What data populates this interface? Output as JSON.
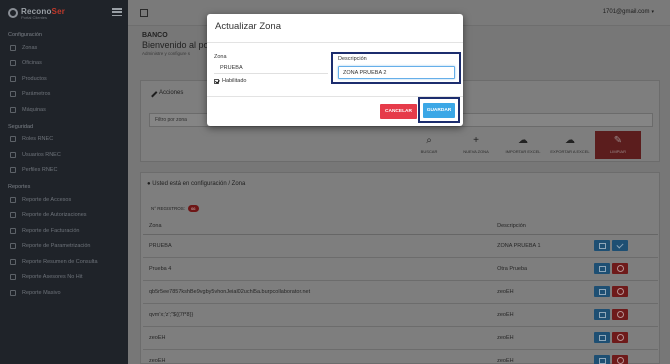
{
  "brand": {
    "name_main": "Recono",
    "name_accent": "Ser",
    "subtitle": "Portal Clientes"
  },
  "sidebar": {
    "sections": [
      {
        "title": "Configuración",
        "items": [
          "Zonas",
          "Oficinas",
          "Productos",
          "Parámetros",
          "Máquinas"
        ]
      },
      {
        "title": "Seguridad",
        "items": [
          "Roles RNEC",
          "Usuarios RNEC",
          "Perfiles RNEC"
        ]
      },
      {
        "title": "Reportes",
        "items": [
          "Reporte de Accesos",
          "Reporte de Autorizaciones",
          "Reporte de Facturación",
          "Reporte de Parametrización",
          "Reporte Resumen de Consulta",
          "Reporte Asesores No Hit",
          "Reporte Masivo"
        ]
      }
    ]
  },
  "topbar": {
    "user": "1701@gmail.com",
    "caret": "▾"
  },
  "page": {
    "bank": "BANCO",
    "welcome": "Bienvenido al po",
    "subtitle": "Administre y configure s"
  },
  "acciones": {
    "title": "Acciones",
    "filter_placeholder": "Filtro por zona",
    "buttons": [
      {
        "label": "BUSCAR",
        "glyph": "⌕"
      },
      {
        "label": "NUEVA ZONA",
        "glyph": "+"
      },
      {
        "label": "IMPORTAR EXCEL",
        "glyph": "☁"
      },
      {
        "label": "EXPORTAR A EXCEL",
        "glyph": "☁"
      },
      {
        "label": "LIMPIAR",
        "glyph": "✎"
      }
    ]
  },
  "config": {
    "title": "Usted está en configuración / Zona",
    "registros_label": "N° REGISTROS:",
    "registros_count": "66",
    "columns": [
      "Zona",
      "Descripción"
    ],
    "rows": [
      {
        "zona": "PRUEBA",
        "descripcion": "ZONA PRUEBA 1",
        "actions": [
          "edit",
          "ok"
        ]
      },
      {
        "zona": "Prueba 4",
        "descripcion": "Otra Prueba",
        "actions": [
          "edit",
          "del"
        ]
      },
      {
        "zona": "qb5r5ee7857kshBe9vgby5vhonJeial02uchl5a.burpcollaborator.net",
        "descripcion": "zeoEH",
        "actions": [
          "edit",
          "del"
        ]
      },
      {
        "zona": "qvm'x;'z';\"${{7f*8}}",
        "descripcion": "zeoEH",
        "actions": [
          "edit",
          "del"
        ]
      },
      {
        "zona": "zeoEH",
        "descripcion": "zeoEH",
        "actions": [
          "edit",
          "del"
        ]
      },
      {
        "zona": "zeoEH",
        "descripcion": "zeoEH",
        "actions": [
          "edit",
          "del"
        ]
      }
    ]
  },
  "modal": {
    "title": "Actualizar Zona",
    "zona_label": "Zona",
    "zona_value": "PRUEBA",
    "habilitado_label": "Habilitado",
    "descripcion_label": "Descripción",
    "descripcion_value": "ZONA PRUEBA 2",
    "cancel_label": "CANCELAR",
    "save_label": "GUARDAR"
  }
}
